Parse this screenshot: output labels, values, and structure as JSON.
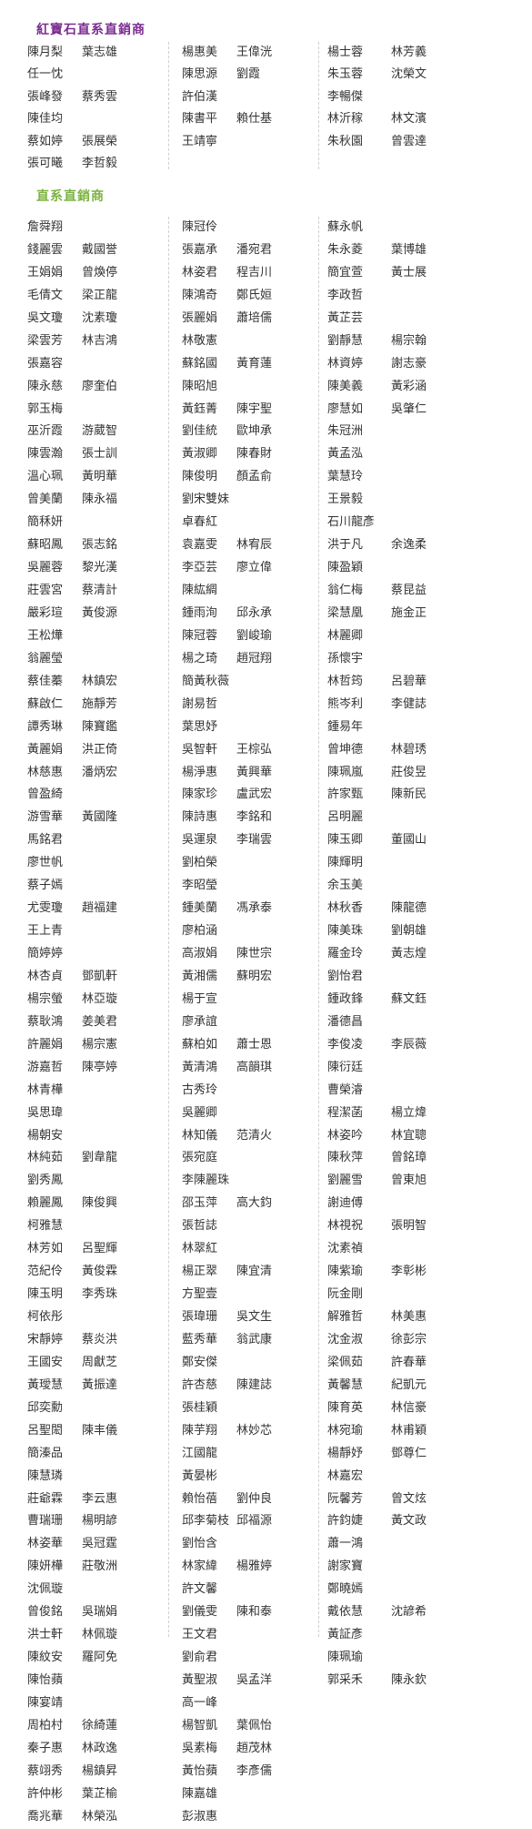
{
  "sections": [
    {
      "title": "紅寶石直系直銷商",
      "columns": [
        [
          [
            "陳月梨",
            "葉志雄"
          ],
          [
            "任一忱",
            ""
          ],
          [
            "張峰發",
            "蔡秀雲"
          ],
          [
            "陳佳均",
            ""
          ],
          [
            "蔡如婷",
            "張展榮"
          ],
          [
            "張可曦",
            "李哲毅"
          ]
        ],
        [
          [
            "楊惠美",
            "王偉洸"
          ],
          [
            "陳思源",
            "劉霞"
          ],
          [
            "許伯漢",
            ""
          ],
          [
            "陳書平",
            "賴仕基"
          ],
          [
            "王靖寧",
            ""
          ]
        ],
        [
          [
            "楊士蓉",
            "林芳義"
          ],
          [
            "朱玉蓉",
            "沈榮文"
          ],
          [
            "李暢傑",
            ""
          ],
          [
            "林沂稼",
            "林文濱"
          ],
          [
            "朱秋園",
            "曾雲達"
          ]
        ]
      ]
    },
    {
      "title": "直系直銷商",
      "columns": [
        [
          [
            "詹舜翔",
            ""
          ],
          [
            "錢麗雲",
            "戴國誉"
          ],
          [
            "王娟娟",
            "曾煥停"
          ],
          [
            "毛倩文",
            "梁正龍"
          ],
          [
            "吳文瓊",
            "沈素瓊"
          ],
          [
            "梁雲芳",
            "林吉鴻"
          ],
          [
            "張嘉容",
            ""
          ],
          [
            "陳永慈",
            "廖奎伯"
          ],
          [
            "郭玉梅",
            ""
          ],
          [
            "巫沂霞",
            "游葳智"
          ],
          [
            "陳雲瀚",
            "張士訓"
          ],
          [
            "溫心珮",
            "黃明華"
          ],
          [
            "曾美蘭",
            "陳永福"
          ],
          [
            "簡秝妍",
            ""
          ],
          [
            "蘇昭鳳",
            "張志銘"
          ],
          [
            "吳麗蓉",
            "黎光漢"
          ],
          [
            "莊雲宮",
            "蔡清計"
          ],
          [
            "嚴彩瑄",
            "黃俊源"
          ],
          [
            "王松燁",
            ""
          ],
          [
            "翁麗瑩",
            ""
          ],
          [
            "蔡佳蓁",
            "林鎮宏"
          ],
          [
            "蘇啟仁",
            "施靜芳"
          ],
          [
            "譚秀琳",
            "陳寶鑑"
          ],
          [
            "黃麗娟",
            "洪正倚"
          ],
          [
            "林慈惠",
            "潘炳宏"
          ],
          [
            "曾盈綺",
            ""
          ],
          [
            "游雪華",
            "黃國隆"
          ],
          [
            "馬銘君",
            ""
          ],
          [
            "廖世帆",
            ""
          ],
          [
            "蔡子嫣",
            ""
          ],
          [
            "尤雯瓊",
            "趙福建"
          ],
          [
            "王上青",
            ""
          ],
          [
            "簡婷婷",
            ""
          ],
          [
            "林杏貞",
            "鄧凱軒"
          ],
          [
            "楊宗螢",
            "林亞璇"
          ],
          [
            "蔡耿鴻",
            "姜美君"
          ],
          [
            "許麗娟",
            "楊宗憲"
          ],
          [
            "游嘉哲",
            "陳亭婷"
          ],
          [
            "林青樺",
            ""
          ],
          [
            "吳思瑋",
            ""
          ],
          [
            "楊朝安",
            ""
          ],
          [
            "林純茹",
            "劉韋龍"
          ],
          [
            "劉秀鳳",
            ""
          ],
          [
            "賴麗鳳",
            "陳俊興"
          ],
          [
            "柯雅慧",
            ""
          ],
          [
            "林芳如",
            "呂聖輝"
          ],
          [
            "范紀伶",
            "黃俊霖"
          ],
          [
            "陳玉明",
            "李秀珠"
          ],
          [
            "柯依彤",
            ""
          ],
          [
            "宋靜婷",
            "蔡炎洪"
          ],
          [
            "王國安",
            "周獻芝"
          ],
          [
            "黃璦慧",
            "黃振達"
          ],
          [
            "邱奕勳",
            ""
          ],
          [
            "呂聖閎",
            "陳丰儀"
          ],
          [
            "簡溱品",
            ""
          ],
          [
            "陳慧璘",
            ""
          ],
          [
            "莊爺霖",
            "李云惠"
          ],
          [
            "曹瑞珊",
            "楊明諺"
          ],
          [
            "林姿華",
            "吳冠霆"
          ],
          [
            "陳妍樺",
            "莊敬洲"
          ],
          [
            "沈佩璇",
            ""
          ],
          [
            "曾俊銘",
            "吳瑞娟"
          ],
          [
            "洪士軒",
            "林佩璇"
          ],
          [
            "陳紋安",
            "羅阿免"
          ],
          [
            "陳怡蘋",
            ""
          ],
          [
            "陳宴靖",
            ""
          ],
          [
            "周柏村",
            "徐綺蓮"
          ],
          [
            "秦子惠",
            "林政逸"
          ],
          [
            "蔡翊秀",
            "楊鎮昇"
          ],
          [
            "許仲彬",
            "葉芷榆"
          ],
          [
            "喬兆華",
            "林榮泓"
          ]
        ],
        [
          [
            "陳冠伶",
            ""
          ],
          [
            "張嘉承",
            "潘宛君"
          ],
          [
            "林姿君",
            "程吉川"
          ],
          [
            "陳鴻奇",
            "鄭氏姮"
          ],
          [
            "張麗娟",
            "蕭培儒"
          ],
          [
            "林敬憲",
            ""
          ],
          [
            "蘇銘國",
            "黃育蓮"
          ],
          [
            "陳昭旭",
            ""
          ],
          [
            "黃鈺菁",
            "陳宇聖"
          ],
          [
            "劉佳統",
            "歐坤承"
          ],
          [
            "黃淑卿",
            "陳春財"
          ],
          [
            "陳俊明",
            "顏孟俞"
          ],
          [
            "劉宋雙妹",
            ""
          ],
          [
            "卓春紅",
            ""
          ],
          [
            "袁嘉雯",
            "林宥辰"
          ],
          [
            "李亞芸",
            "廖立偉"
          ],
          [
            "陳紘綢",
            ""
          ],
          [
            "鍾雨洵",
            "邱永承"
          ],
          [
            "陳冠蓉",
            "劉峻瑜"
          ],
          [
            "楊之琦",
            "趙冠翔"
          ],
          [
            "簡黃秋薇",
            ""
          ],
          [
            "謝易哲",
            ""
          ],
          [
            "葉思妤",
            ""
          ],
          [
            "吳智軒",
            "王棕弘"
          ],
          [
            "楊淨惠",
            "黃興華"
          ],
          [
            "陳家珍",
            "盧武宏"
          ],
          [
            "陳詩惠",
            "李銘和"
          ],
          [
            "吳運泉",
            "李瑞雲"
          ],
          [
            "劉柏榮",
            ""
          ],
          [
            "李昭瑩",
            ""
          ],
          [
            "鍾美蘭",
            "馮承泰"
          ],
          [
            "廖柏涵",
            ""
          ],
          [
            "高淑娟",
            "陳世宗"
          ],
          [
            "黃湘儒",
            "蘇明宏"
          ],
          [
            "楊于宣",
            ""
          ],
          [
            "廖承誼",
            ""
          ],
          [
            "蘇柏如",
            "蕭士恩"
          ],
          [
            "黃清鴻",
            "高韻琪"
          ],
          [
            "古秀玲",
            ""
          ],
          [
            "吳麗卿",
            ""
          ],
          [
            "林知儀",
            "范清火"
          ],
          [
            "張宛庭",
            ""
          ],
          [
            "李陳麗珠",
            ""
          ],
          [
            "邵玉萍",
            "高大鈞"
          ],
          [
            "張哲誌",
            ""
          ],
          [
            "林翠紅",
            ""
          ],
          [
            "楊正翠",
            "陳宜清"
          ],
          [
            "方聖壹",
            ""
          ],
          [
            "張瑋珊",
            "吳文生"
          ],
          [
            "藍秀華",
            "翁武康"
          ],
          [
            "鄭安傑",
            ""
          ],
          [
            "許杏慈",
            "陳建誌"
          ],
          [
            "張桂穎",
            ""
          ],
          [
            "陳芋翔",
            "林妙芯"
          ],
          [
            "江國龍",
            ""
          ],
          [
            "黃晏彬",
            ""
          ],
          [
            "賴怡蓓",
            "劉仲良"
          ],
          [
            "邱李菊枝",
            "邱福源"
          ],
          [
            "劉怡含",
            ""
          ],
          [
            "林家緯",
            "楊雅婷"
          ],
          [
            "許文馨",
            ""
          ],
          [
            "劉儀雯",
            "陳和泰"
          ],
          [
            "王文君",
            ""
          ],
          [
            "劉俞君",
            ""
          ],
          [
            "黃聖淑",
            "吳孟洋"
          ],
          [
            "高一峰",
            ""
          ],
          [
            "楊智凱",
            "葉佩怡"
          ],
          [
            "吳素梅",
            "趙茂林"
          ],
          [
            "黃怡蘋",
            "李彥儒"
          ],
          [
            "陳嘉雄",
            ""
          ],
          [
            "彭淑惠",
            ""
          ]
        ],
        [
          [
            "蘇永帆",
            ""
          ],
          [
            "朱永菱",
            "葉博雄"
          ],
          [
            "簡宜萱",
            "黃士展"
          ],
          [
            "李政哲",
            ""
          ],
          [
            "黃芷芸",
            ""
          ],
          [
            "劉靜慧",
            "楊宗翰"
          ],
          [
            "林資婷",
            "謝志豪"
          ],
          [
            "陳美義",
            "黃彩涵"
          ],
          [
            "廖慧如",
            "吳肇仁"
          ],
          [
            "朱冠洲",
            ""
          ],
          [
            "黃孟泓",
            ""
          ],
          [
            "葉慧玲",
            ""
          ],
          [
            "王景毅",
            ""
          ],
          [
            "石川龍彥",
            ""
          ],
          [
            "洪于凡",
            "余逸柔"
          ],
          [
            "陳盈穎",
            ""
          ],
          [
            "翁仁梅",
            "蔡昆益"
          ],
          [
            "梁慧凰",
            "施金正"
          ],
          [
            "林麗卿",
            ""
          ],
          [
            "孫懷宇",
            ""
          ],
          [
            "林哲筠",
            "呂碧華"
          ],
          [
            "熊岑利",
            "李健誌"
          ],
          [
            "鍾易年",
            ""
          ],
          [
            "曾坤德",
            "林碧琇"
          ],
          [
            "陳珮嵐",
            "莊俊昱"
          ],
          [
            "許家甄",
            "陳新民"
          ],
          [
            "呂明麗",
            ""
          ],
          [
            "陳玉卿",
            "董國山"
          ],
          [
            "陳輝明",
            ""
          ],
          [
            "余玉美",
            ""
          ],
          [
            "林秋香",
            "陳龍德"
          ],
          [
            "陳美珠",
            "劉朝雄"
          ],
          [
            "羅金玲",
            "黃志煌"
          ],
          [
            "劉怡君",
            ""
          ],
          [
            "鍾政鋒",
            "蘇文鈺"
          ],
          [
            "潘德昌",
            ""
          ],
          [
            "李俊凌",
            "李辰薇"
          ],
          [
            "陳衍廷",
            ""
          ],
          [
            "曹榮濬",
            ""
          ],
          [
            "程潔菡",
            "楊立煒"
          ],
          [
            "林姿吟",
            "林宜聰"
          ],
          [
            "陳秋萍",
            "曾銘璋"
          ],
          [
            "劉麗雪",
            "曾東旭"
          ],
          [
            "謝迪傅",
            ""
          ],
          [
            "林視祝",
            "張明智"
          ],
          [
            "沈素禎",
            ""
          ],
          [
            "陳紫瑜",
            "李彰彬"
          ],
          [
            "阮金剛",
            ""
          ],
          [
            "解雅哲",
            "林美惠"
          ],
          [
            "沈金淑",
            "徐彭宗"
          ],
          [
            "梁佩茹",
            "許春華"
          ],
          [
            "黃馨慧",
            "紀凱元"
          ],
          [
            "陳育英",
            "林信豪"
          ],
          [
            "林宛瑜",
            "林甫穎"
          ],
          [
            "楊靜妤",
            "鄧尊仁"
          ],
          [
            "林嘉宏",
            ""
          ],
          [
            "阮馨芳",
            "曾文炫"
          ],
          [
            "許鈞婕",
            "黃文政"
          ],
          [
            "蕭一鴻",
            ""
          ],
          [
            "謝家寶",
            ""
          ],
          [
            "鄭曉嫣",
            ""
          ],
          [
            "戴依慧",
            "沈諺希"
          ],
          [
            "黃証彥",
            ""
          ],
          [
            "陳珮瑜",
            ""
          ],
          [
            "郭采禾",
            "陳永欽"
          ]
        ]
      ]
    }
  ]
}
